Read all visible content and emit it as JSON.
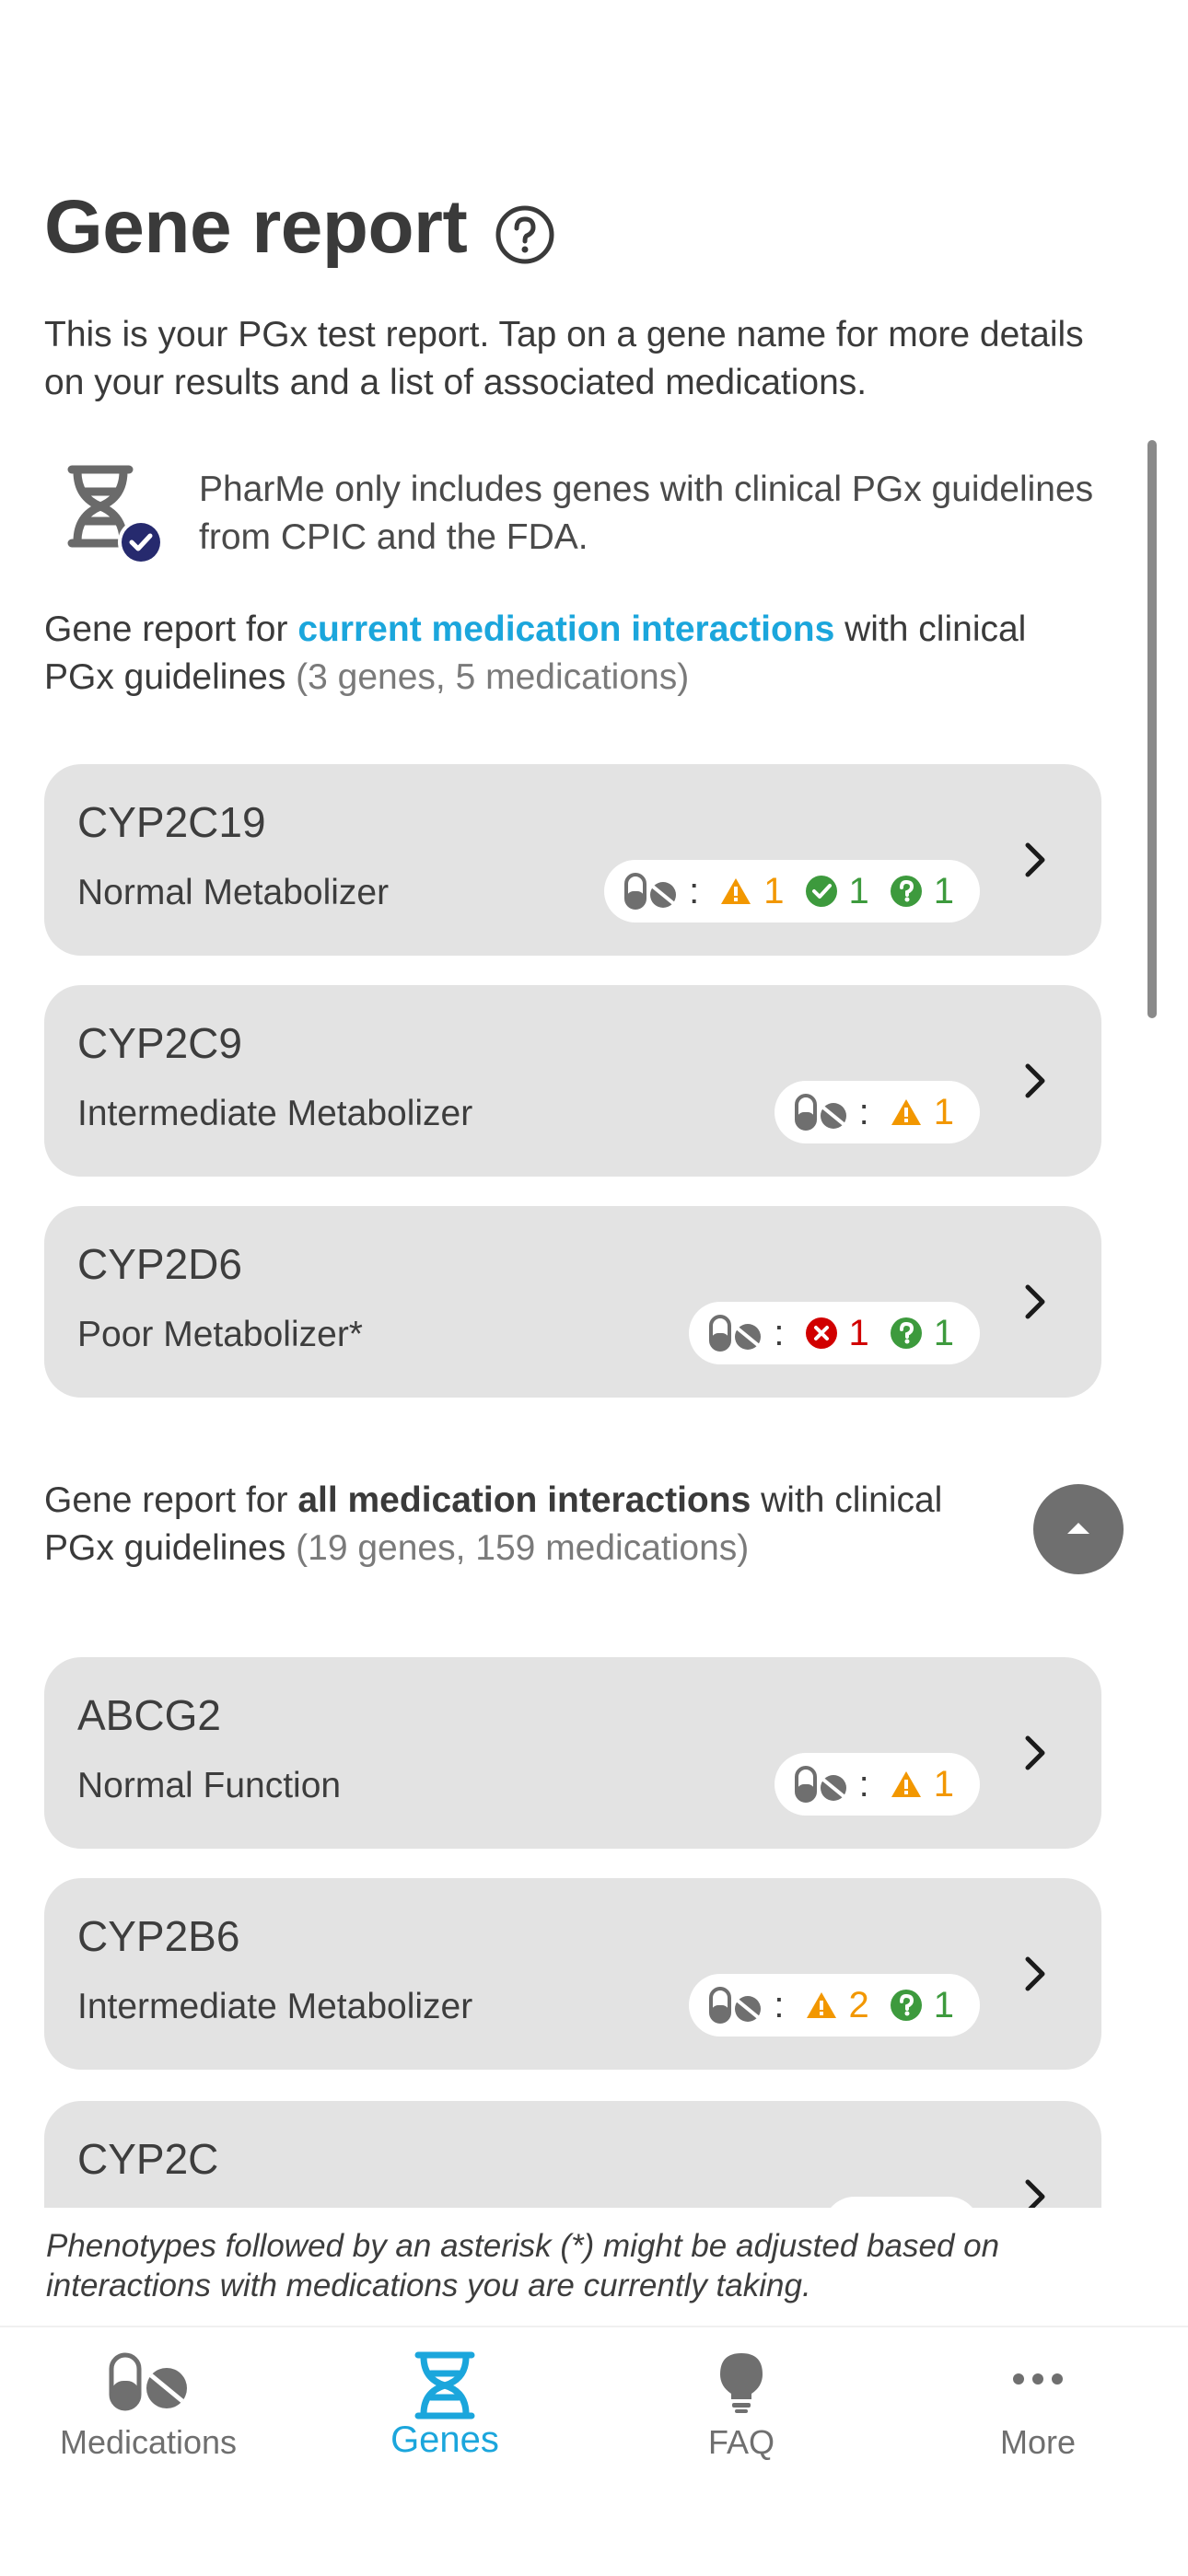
{
  "header": {
    "title": "Gene report",
    "intro": "This is your PGx test report. Tap on a gene name for more details on your results and a list of associated medications."
  },
  "info": {
    "text": "PharMe only includes genes with clinical PGx guidelines from CPIC and the FDA."
  },
  "current_section": {
    "prefix": "Gene report for ",
    "highlight": "current medication interactions",
    "middle": " with clinical PGx guidelines ",
    "counts": "(3 genes, 5 medications)"
  },
  "all_section": {
    "prefix": "Gene report for ",
    "highlight": "all medication interactions",
    "middle": " with clinical PGx guidelines ",
    "counts": "(19 genes, 159 medications)"
  },
  "current_genes": [
    {
      "name": "CYP2C19",
      "phenotype": "Normal Metabolizer",
      "warning": "1",
      "ok": "1",
      "unknown": "1"
    },
    {
      "name": "CYP2C9",
      "phenotype": "Intermediate Metabolizer",
      "warning": "1"
    },
    {
      "name": "CYP2D6",
      "phenotype": "Poor Metabolizer*",
      "danger": "1",
      "unknown": "1"
    }
  ],
  "all_genes": [
    {
      "name": "ABCG2",
      "phenotype": "Normal Function",
      "warning": "1"
    },
    {
      "name": "CYP2B6",
      "phenotype": "Intermediate Metabolizer",
      "warning": "2",
      "unknown": "1"
    },
    {
      "name": "CYP2C",
      "phenotype": ""
    }
  ],
  "colon": ":",
  "footnote": "Phenotypes followed by an asterisk (*) might be adjusted based on interactions with medications you are currently taking.",
  "tabs": [
    {
      "label": "Medications",
      "icon": "medications-icon",
      "active": false
    },
    {
      "label": "Genes",
      "icon": "dna-icon",
      "active": true
    },
    {
      "label": "FAQ",
      "icon": "lightbulb-icon",
      "active": false
    },
    {
      "label": "More",
      "icon": "more-dots-icon",
      "active": false
    }
  ],
  "colors": {
    "accent": "#1ba6dc",
    "warning": "#f29700",
    "ok": "#3d9a3d",
    "danger": "#d10000",
    "card": "#e3e3e3",
    "badge_navy": "#262a6e"
  }
}
